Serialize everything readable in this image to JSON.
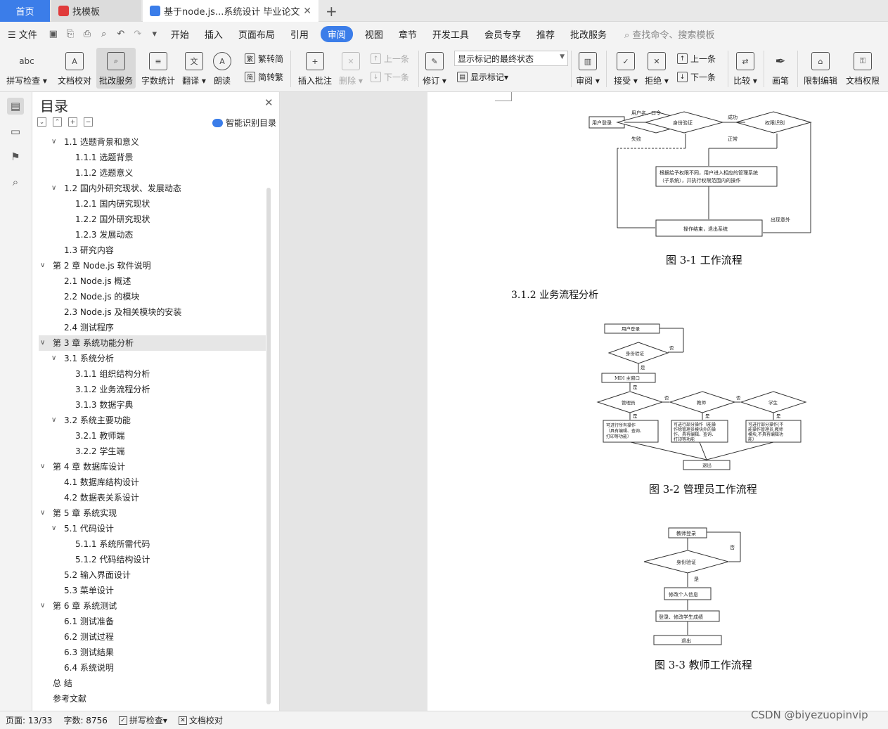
{
  "tabs": {
    "home": "首页",
    "template": "找模板",
    "doc": "基于node.js...系统设计 毕业论文",
    "new_tab": "+"
  },
  "menu": {
    "file": "文件",
    "items": [
      "开始",
      "插入",
      "页面布局",
      "引用",
      "审阅",
      "视图",
      "章节",
      "开发工具",
      "会员专享",
      "推荐",
      "批改服务"
    ],
    "active": "审阅",
    "search": "查找命令、搜索模板"
  },
  "ribbon": {
    "spell_check": "拼写检查",
    "doc_check": "文档校对",
    "correction": "批改服务",
    "word_count": "字数统计",
    "translate": "翻译",
    "read_aloud": "朗读",
    "to_traditional": "繁转简",
    "to_simplified": "简转繁",
    "insert_comment": "插入批注",
    "delete": "删除",
    "prev": "上一条",
    "next": "下一条",
    "revise": "修订",
    "markup_state": "显示标记的最终状态",
    "show_markup": "显示标记",
    "review": "审阅",
    "accept": "接受",
    "reject": "拒绝",
    "prev2": "上一条",
    "next2": "下一条",
    "compare": "比较",
    "pen": "画笔",
    "restrict_edit": "限制编辑",
    "doc_permission": "文档权限"
  },
  "toc": {
    "title": "目录",
    "smart": "智能识别目录",
    "items": [
      {
        "label": "1.1 选题背景和意义",
        "level": 2,
        "caret": true
      },
      {
        "label": "1.1.1 选题背景",
        "level": 3,
        "caret": false
      },
      {
        "label": "1.1.2 选题意义",
        "level": 3,
        "caret": false
      },
      {
        "label": "1.2 国内外研究现状、发展动态",
        "level": 2,
        "caret": true
      },
      {
        "label": "1.2.1 国内研究现状",
        "level": 3,
        "caret": false
      },
      {
        "label": "1.2.2 国外研究现状",
        "level": 3,
        "caret": false
      },
      {
        "label": "1.2.3 发展动态",
        "level": 3,
        "caret": false
      },
      {
        "label": "1.3 研究内容",
        "level": 2,
        "caret": false
      },
      {
        "label": "第 2 章  Node.js 软件说明",
        "level": 1,
        "caret": true
      },
      {
        "label": "2.1 Node.js 概述",
        "level": 2,
        "caret": false
      },
      {
        "label": "2.2 Node.js 的模块",
        "level": 2,
        "caret": false
      },
      {
        "label": "2.3 Node.js 及相关模块的安装",
        "level": 2,
        "caret": false
      },
      {
        "label": "2.4  测试程序",
        "level": 2,
        "caret": false
      },
      {
        "label": "第 3 章  系统功能分析",
        "level": 1,
        "caret": true,
        "selected": true
      },
      {
        "label": "3.1 系统分析",
        "level": 2,
        "caret": true
      },
      {
        "label": "3.1.1 组织结构分析",
        "level": 3,
        "caret": false
      },
      {
        "label": "3.1.2 业务流程分析",
        "level": 3,
        "caret": false
      },
      {
        "label": "3.1.3 数据字典",
        "level": 3,
        "caret": false
      },
      {
        "label": "3.2 系统主要功能",
        "level": 2,
        "caret": true
      },
      {
        "label": "3.2.1  教师端",
        "level": 3,
        "caret": false
      },
      {
        "label": "3.2.2  学生端",
        "level": 3,
        "caret": false
      },
      {
        "label": "第 4 章  数据库设计",
        "level": 1,
        "caret": true
      },
      {
        "label": "4.1 数据库结构设计",
        "level": 2,
        "caret": false
      },
      {
        "label": "4.2 数据表关系设计",
        "level": 2,
        "caret": false
      },
      {
        "label": "第 5 章  系统实现",
        "level": 1,
        "caret": true
      },
      {
        "label": "5.1 代码设计",
        "level": 2,
        "caret": true
      },
      {
        "label": "5.1.1 系统所需代码",
        "level": 3,
        "caret": false
      },
      {
        "label": "5.1.2 代码结构设计",
        "level": 3,
        "caret": false
      },
      {
        "label": "5.2 输入界面设计",
        "level": 2,
        "caret": false
      },
      {
        "label": "5.3 菜单设计",
        "level": 2,
        "caret": false
      },
      {
        "label": "第 6 章  系统测试",
        "level": 1,
        "caret": true
      },
      {
        "label": "6.1 测试准备",
        "level": 2,
        "caret": false
      },
      {
        "label": "6.2 测试过程",
        "level": 2,
        "caret": false
      },
      {
        "label": "6.3 测试结果",
        "level": 2,
        "caret": false
      },
      {
        "label": "6.4 系统说明",
        "level": 2,
        "caret": false
      },
      {
        "label": "总    结",
        "level": 0,
        "caret": false
      },
      {
        "label": "参考文献",
        "level": 0,
        "caret": false
      }
    ]
  },
  "document": {
    "fig1": {
      "caption": "图 3-1  工作流程",
      "user_login": "用户登录",
      "user_pwd": "用户名、口令",
      "auth": "身份验证",
      "success": "成功",
      "perm": "权限识别",
      "fail": "失败",
      "normal": "正常",
      "process": "根据给予权限不同，用户进入相应的管理系统（子系统），并执行权限范围内的操作",
      "process_line1": "根据给予权限不同，用户进入相应的管理系统",
      "process_line2": "（子系统），并执行权限范围内的操作",
      "end": "操作结束，退出系统",
      "exception": "出现意外"
    },
    "section_heading": "3.1.2 业务流程分析",
    "fig2": {
      "caption": "图 3-2  管理员工作流程",
      "user_login": "用户登录",
      "auth": "身份验证",
      "no": "否",
      "yes": "是",
      "mdi": "MDI 主窗口",
      "admin": "管理员",
      "teacher": "教师",
      "student": "学生",
      "admin_ops": [
        "可进行所有操作",
        "（具有编辑、查询、",
        "打印等功能）"
      ],
      "teacher_ops": [
        "可进行部分操作（能操",
        "作除管理员模块外的操",
        "作，具有编辑、查询、",
        "打印等功能"
      ],
      "student_ops": [
        "可进行部分操作(不",
        "能操作管理员,教师",
        "模块,不具有编辑功",
        "能）"
      ],
      "exit": "退出"
    },
    "fig3": {
      "caption": "图 3-3  教师工作流程",
      "teacher_login": "教师登录",
      "auth": "身份验证",
      "no": "否",
      "yes": "是",
      "modify_info": "修改个人信息",
      "grades": "登录、修改学生成绩",
      "exit": "退出"
    }
  },
  "status": {
    "page": "页面: 13/33",
    "words": "字数: 8756",
    "spell": "拼写检查",
    "doc_check": "文档校对"
  },
  "watermark": "CSDN @biyezuopinvip",
  "colors": {
    "accent": "#3b7de9",
    "ribbon_bg": "#f3f3f3",
    "doc_bg": "#e5e5e5"
  }
}
